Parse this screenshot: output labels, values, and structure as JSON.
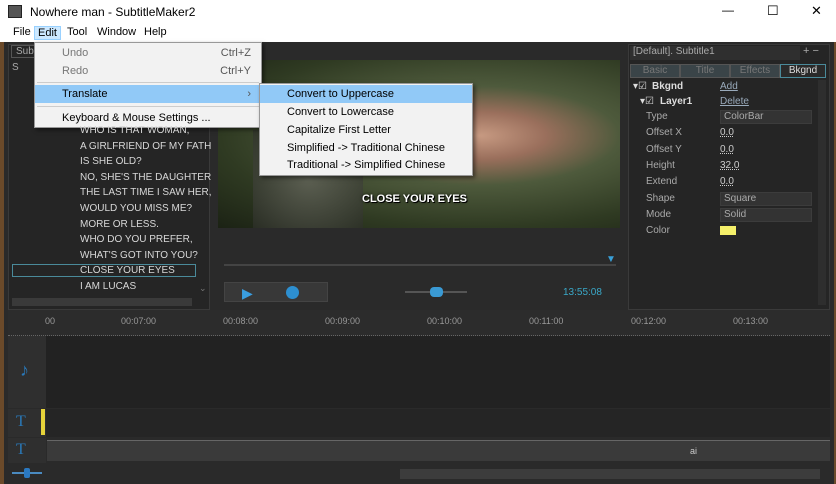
{
  "window": {
    "title": "Nowhere man - SubtitleMaker2",
    "minimize": "—",
    "maximize": "☐",
    "close": "✕"
  },
  "menubar": [
    "File",
    "Edit",
    "Tool",
    "Window",
    "Help"
  ],
  "edit_menu": {
    "undo": "Undo",
    "undo_sc": "Ctrl+Z",
    "redo": "Redo",
    "redo_sc": "Ctrl+Y",
    "translate": "Translate",
    "keyboard": "Keyboard & Mouse Settings ..."
  },
  "translate_menu": [
    "Convert to Uppercase",
    "Convert to Lowercase",
    "Capitalize First Letter",
    "Simplified -> Traditional Chinese",
    "Traditional -> Simplified Chinese"
  ],
  "left_panel": {
    "tab": "Sub",
    "col": "S",
    "subtitles": [
      "WHO IS THAT WOMAN,",
      "A GIRLFRIEND OF MY FATH",
      "IS SHE OLD?",
      "NO, SHE'S THE DAUGHTER",
      "THE LAST TIME I SAW HER,",
      "WOULD YOU MISS ME?",
      "MORE OR LESS.",
      "WHO DO YOU PREFER,",
      "WHAT'S GOT INTO YOU?",
      "CLOSE YOUR EYES",
      "I AM LUCAS"
    ],
    "selected_index": 9
  },
  "video": {
    "caption": "CLOSE YOUR EYES",
    "time": "13:55:08"
  },
  "right_panel": {
    "style": "[Default]. Subtitle1",
    "tabs": [
      "Basic",
      "Title",
      "Effects",
      "Bkgnd"
    ],
    "bkgnd": "Bkgnd",
    "add": "Add",
    "layer": "Layer1",
    "delete": "Delete",
    "props": [
      {
        "label": "Type",
        "value": "ColorBar",
        "kind": "dropdown"
      },
      {
        "label": "Offset X",
        "value": "0.0"
      },
      {
        "label": "Offset Y",
        "value": "0.0"
      },
      {
        "label": "Height",
        "value": "32.0"
      },
      {
        "label": "Extend",
        "value": "0.0"
      },
      {
        "label": "Shape",
        "value": "Square",
        "kind": "dropdown"
      },
      {
        "label": "Mode",
        "value": "Solid",
        "kind": "dropdown"
      },
      {
        "label": "Color",
        "value": ""
      }
    ],
    "color": "#f5f06a"
  },
  "timeline": {
    "ticks": [
      "00",
      "00:07:00",
      "00:08:00",
      "00:09:00",
      "00:10:00",
      "00:11:00",
      "00:12:00",
      "00:13:00"
    ],
    "clip_label": "ai"
  }
}
